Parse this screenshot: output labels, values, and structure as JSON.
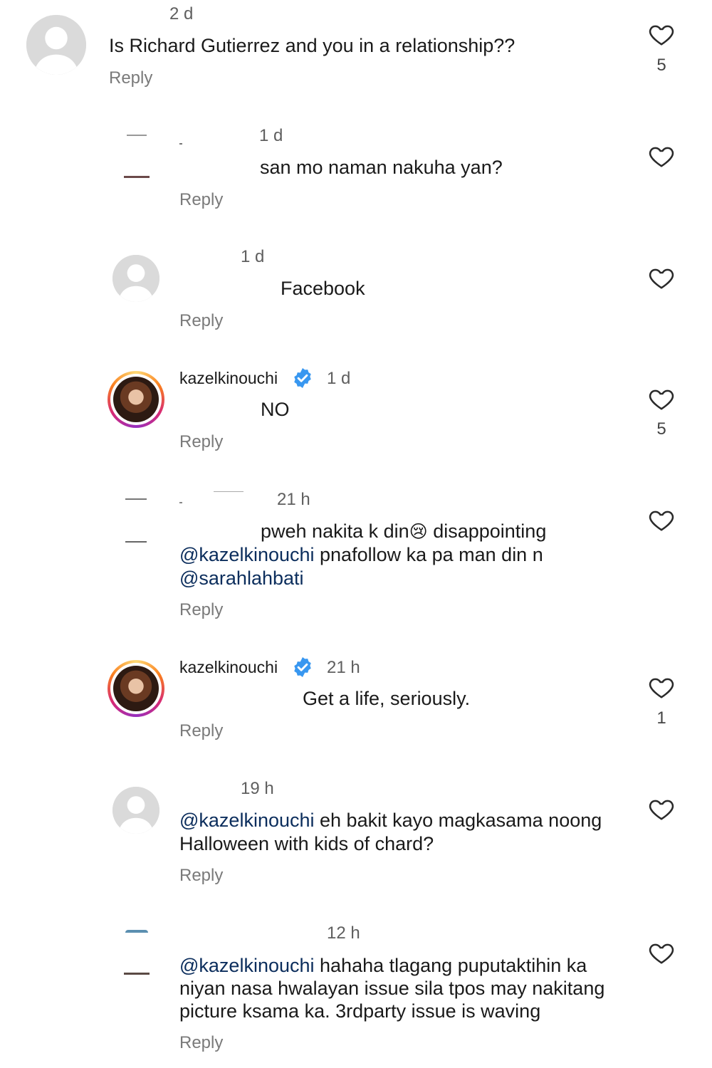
{
  "comments": [
    {
      "time": "2 d",
      "text": "Is Richard Gutierrez and you in a relationship??",
      "reply": "Reply",
      "likes": "5"
    },
    {
      "time": "1 d",
      "text": "san mo naman nakuha yan?",
      "reply": "Reply",
      "likes": ""
    },
    {
      "time": "1 d",
      "text": "Facebook",
      "reply": "Reply",
      "likes": ""
    },
    {
      "username": "kazelkinouchi",
      "time": "1 d",
      "text": "NO",
      "reply": "Reply",
      "likes": "5"
    },
    {
      "time": "21 h",
      "line1": "pweh nakita k din",
      "emoji": "😢",
      "line1b": " disappointing",
      "mention1": "@kazelkinouchi",
      "line2": " pnafollow ka pa man din n",
      "mention2": "@sarahlahbati",
      "reply": "Reply",
      "likes": ""
    },
    {
      "username": "kazelkinouchi",
      "time": "21 h",
      "text": "Get a life, seriously.",
      "reply": "Reply",
      "likes": "1"
    },
    {
      "time": "19 h",
      "mention": "@kazelkinouchi",
      "line1": " eh bakit kayo magkasama noong",
      "line2": "Halloween with kids of chard?",
      "reply": "Reply",
      "likes": ""
    },
    {
      "time": "12 h",
      "mention": "@kazelkinouchi",
      "line1": " hahaha tlagang puputaktihin ka",
      "line2": "niyan nasa hwalayan issue sila tpos may nakitang",
      "line3": "picture ksama ka. 3rdparty issue is waving",
      "reply": "Reply",
      "likes": ""
    }
  ],
  "icons": {
    "heart": "heart-icon",
    "verified": "verified-badge-icon",
    "verified_color": "#3897f0"
  }
}
